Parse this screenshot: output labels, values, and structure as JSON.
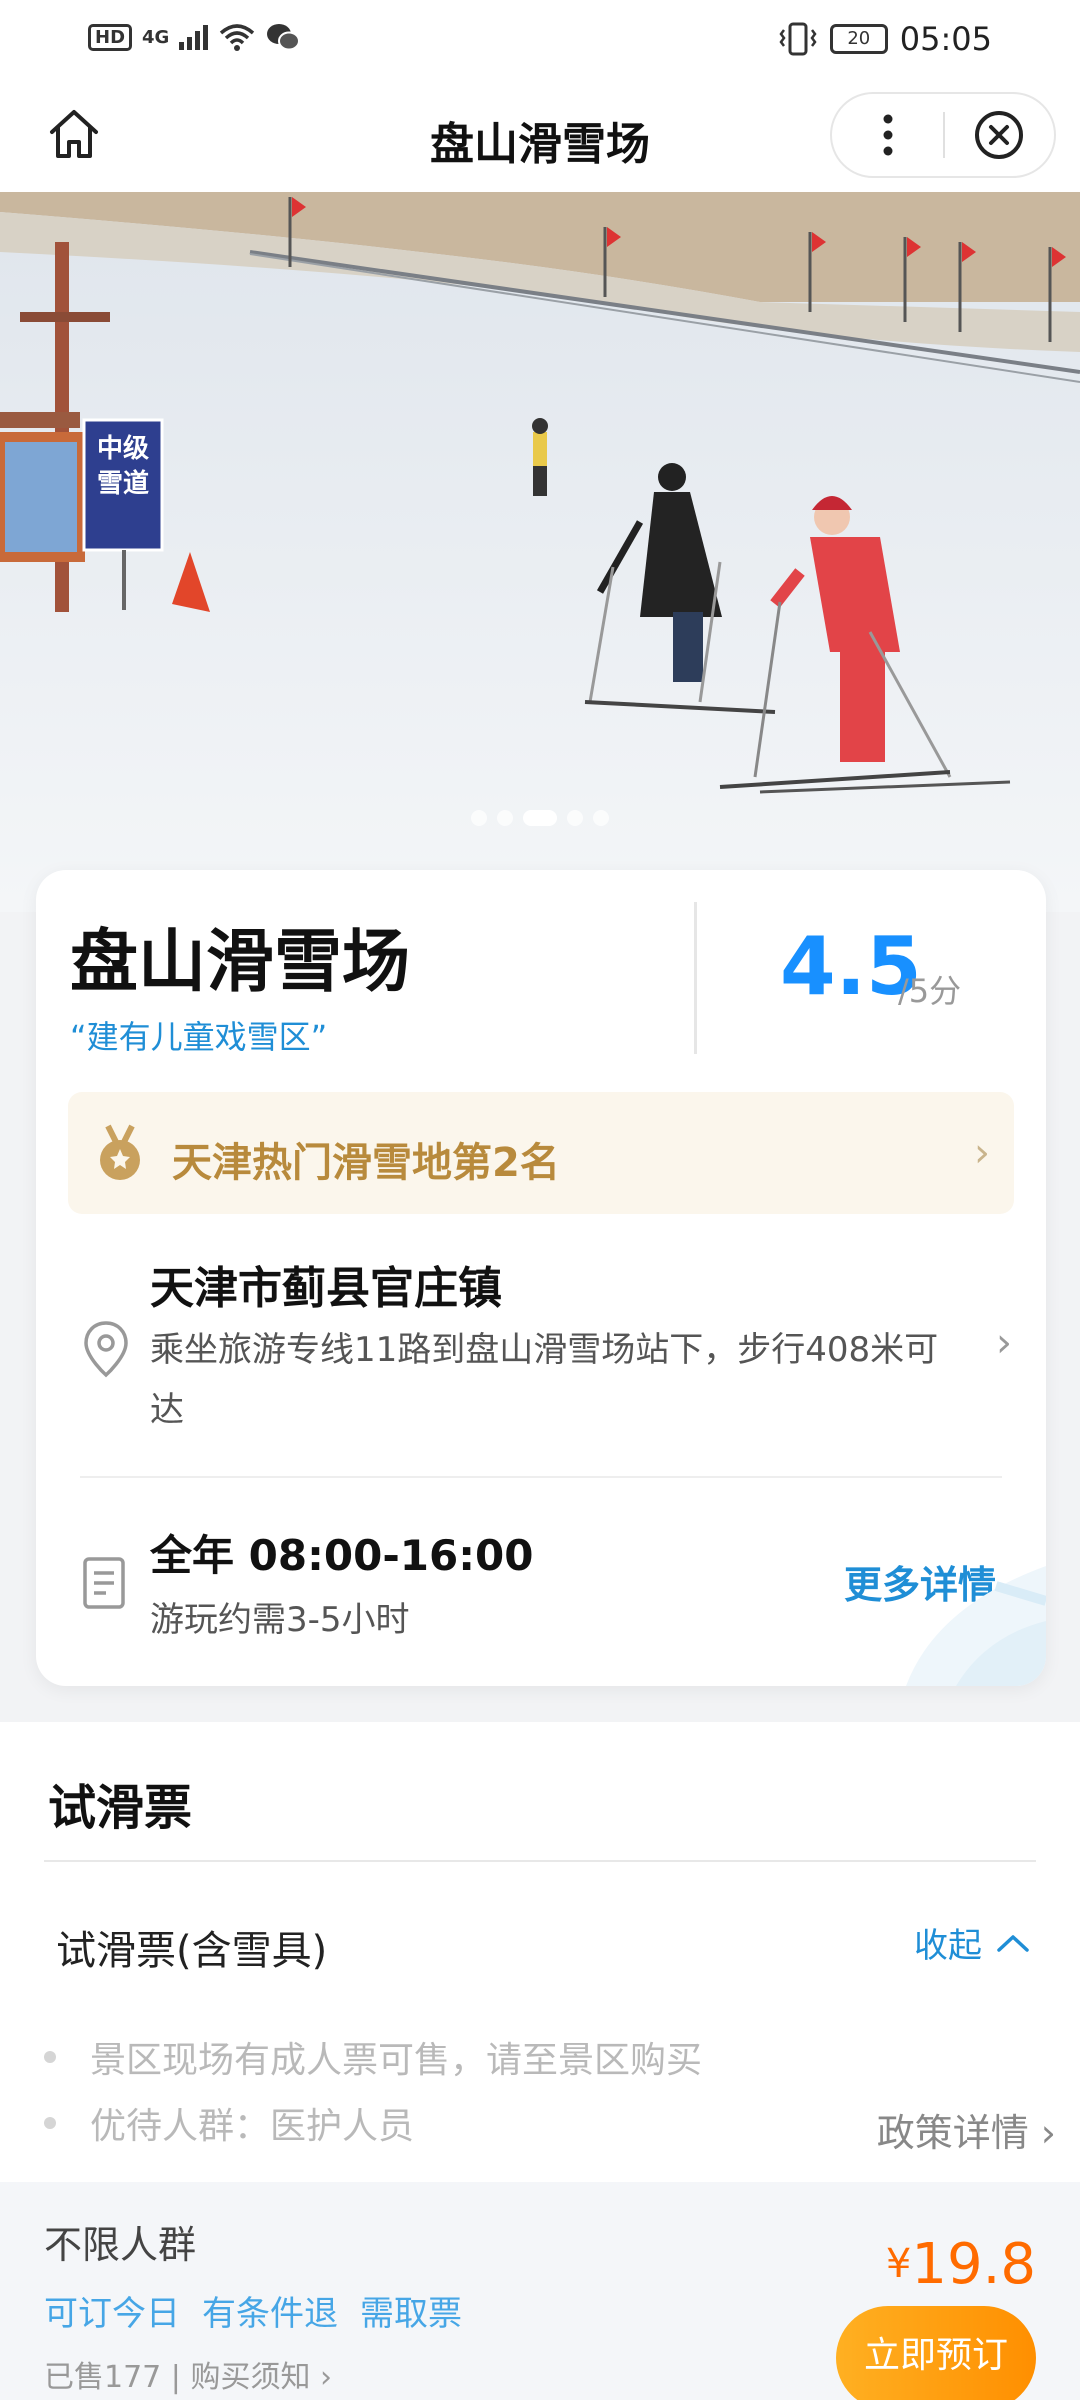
{
  "status_bar": {
    "network": "4G",
    "hd": "HD",
    "battery": "20",
    "time": "05:05"
  },
  "nav": {
    "title": "盘山滑雪场",
    "home_icon": "home-icon",
    "more_icon": "more-vertical-icon",
    "close_icon": "close-circle-icon"
  },
  "hero": {
    "image": "ski-slope-photo",
    "sign_text": "中级雪道",
    "slide_count": 5,
    "active_slide": 3
  },
  "info": {
    "name": "盘山滑雪场",
    "tagline": "“建有儿童戏雪区”",
    "score": "4.5",
    "score_unit": "/5分",
    "rank_text": "天津热门滑雪地第2名",
    "address_title": "天津市蓟县官庄镇",
    "address_desc": "乘坐旅游专线11路到盘山滑雪场站下，步行408米可达",
    "hours_title": "全年 08:00-16:00",
    "hours_sub": "游玩约需3-5小时",
    "more_label": "更多详情"
  },
  "tickets": {
    "section_title": "试滑票",
    "ticket_name": "试滑票(含雪具)",
    "collapse_label": "收起",
    "notes": [
      "景区现场有成人票可售，请至景区购买",
      "优待人群：医护人员"
    ],
    "policy_label": "政策详情"
  },
  "product": {
    "group": "不限人群",
    "tags": [
      "可订今日",
      "有条件退",
      "需取票"
    ],
    "sold_info": "已售177 | 购买须知 ",
    "currency": "¥",
    "price": "19.8",
    "book_label": "立即预订"
  },
  "colors": {
    "accent_blue": "#1890ff",
    "link_blue": "#1f8ed6",
    "price_orange": "#ff6b00",
    "rank_gold": "#b88a3c",
    "book_gradient": [
      "#ffb022",
      "#ff8f00"
    ]
  }
}
